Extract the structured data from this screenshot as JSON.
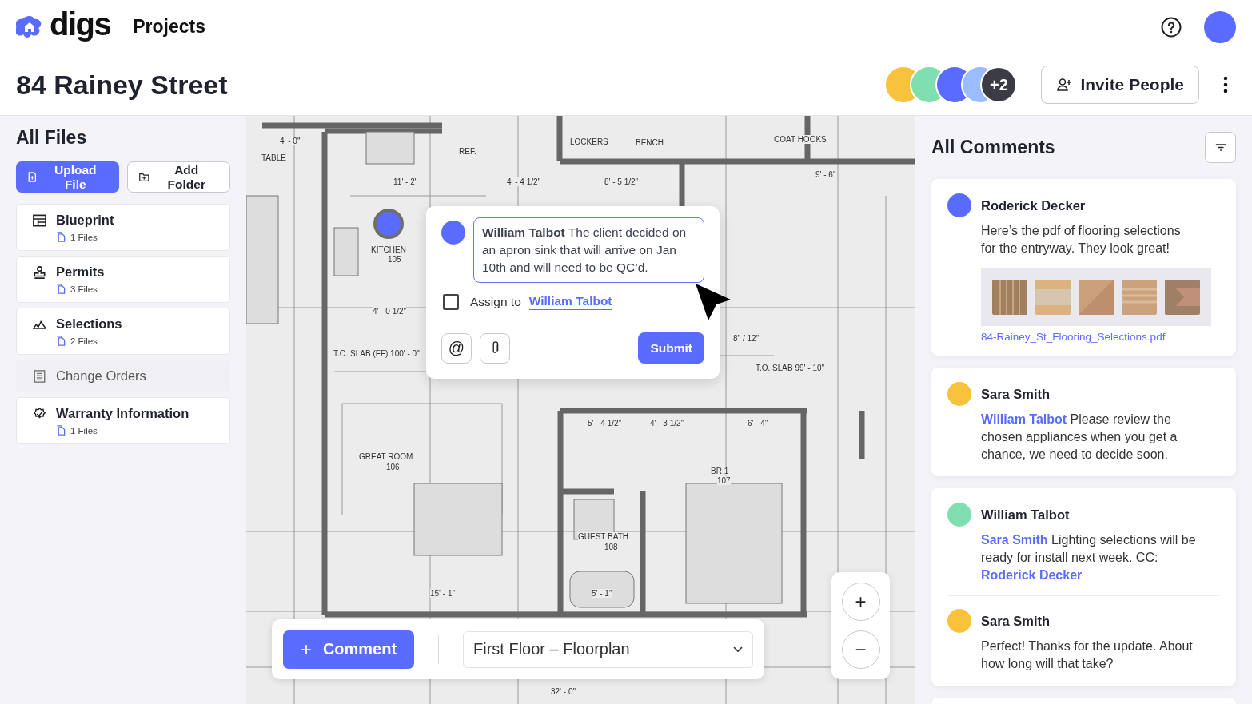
{
  "app": {
    "logo": "digs",
    "nav": "Projects"
  },
  "project": {
    "title": "84 Rainey Street",
    "collaborators": [
      {
        "color": "#f8c23c"
      },
      {
        "color": "#7fdfae"
      },
      {
        "color": "#5a6cff"
      },
      {
        "color": "#9bbcff"
      }
    ],
    "more_count": "+2",
    "invite_button": "Invite People"
  },
  "files": {
    "title": "All Files",
    "upload_button": "Upload File",
    "add_folder_button": "Add Folder",
    "folders": [
      {
        "kind": "blueprint",
        "name": "Blueprint",
        "count": "1 Files",
        "disabled": false
      },
      {
        "kind": "permits",
        "name": "Permits",
        "count": "3 Files",
        "disabled": false
      },
      {
        "kind": "selections",
        "name": "Selections",
        "count": "2 Files",
        "disabled": false
      },
      {
        "kind": "change_orders",
        "name": "Change Orders",
        "disabled": true
      },
      {
        "kind": "warranty",
        "name": "Warranty Information",
        "count": "1 Files",
        "disabled": false
      }
    ]
  },
  "plan": {
    "labels": [
      "TABLE",
      "4' - 0\"",
      "REF.",
      "11' - 2\"",
      "4' - 4 1/2\"",
      "8' - 5 1/2\"",
      "LOCKERS",
      "BENCH",
      "COAT HOOKS",
      "9' - 6\"",
      "KITCHEN",
      "105",
      "4' - 0 1/2\"",
      "T.O. SLAB (FF) 100' - 0\"",
      "T.O. SLAB 99' - 10\"",
      "8\" / 12\"",
      "GREAT ROOM",
      "106",
      "5' - 4 1/2\"",
      "4' - 3 1/2\"",
      "6' - 4\"",
      "BR 1",
      "107",
      "GUEST BATH",
      "108",
      "15' - 1\"",
      "5' - 1\"",
      "32' - 0\""
    ],
    "pin": {
      "color": "#5a6cff"
    },
    "comment_button": "Comment",
    "comment_icon": "+",
    "floor_select": "First Floor – Floorplan",
    "zoom_in": "+",
    "zoom_out": "−"
  },
  "composer": {
    "color": "#5a6cff",
    "text": "**William Talbot** The client decided on an apron sink that will arrive on Jan 10th and will need to be QC’d.",
    "assign_checked": false,
    "assign_label": "Assign to",
    "assignee": "William Talbot",
    "mention_icon": "@",
    "submit": "Submit"
  },
  "comments": {
    "title": "All Comments",
    "threads": [
      {
        "entries": [
          {
            "author": "Roderick Decker",
            "color": "#5a6cff",
            "parts": [
              {
                "kind": "plain",
                "text": "Here’s the pdf of flooring selections for the entryway. They look great!"
              }
            ],
            "attachment": "84-Rainey_St_Flooring_Selections.pdf"
          }
        ]
      },
      {
        "entries": [
          {
            "author": "Sara Smith",
            "color": "#f8c23c",
            "parts": [
              {
                "kind": "mention",
                "text": "William Talbot"
              },
              {
                "kind": "plain",
                "text": " Please review the chosen appliances when you get a chance, we need to decide soon."
              }
            ]
          }
        ]
      },
      {
        "entries": [
          {
            "author": "William Talbot",
            "color": "#7fdfae",
            "parts": [
              {
                "kind": "mention",
                "text": "Sara Smith"
              },
              {
                "kind": "plain",
                "text": " Lighting selections will be ready for install next week. CC: "
              },
              {
                "kind": "mention",
                "text": "Roderick Decker"
              }
            ]
          },
          {
            "author": "Sara Smith",
            "color": "#f8c23c",
            "parts": [
              {
                "kind": "plain",
                "text": "Perfect! Thanks for the update. About how long will that take?"
              }
            ]
          }
        ]
      }
    ]
  }
}
